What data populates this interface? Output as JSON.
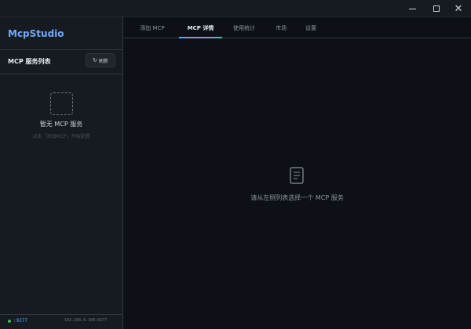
{
  "window": {
    "controls": {
      "minimize": "",
      "maximize": "",
      "close": "✕"
    }
  },
  "sidebar": {
    "brand": "McpStudio",
    "list_title": "MCP 服务列表",
    "refresh_label": "刷新",
    "refresh_icon": "↻",
    "empty_title": "暂无 MCP 服务",
    "empty_hint": "点击「添加MCP」开始配置"
  },
  "status": {
    "port": ":9277",
    "address": "192.168.6.100:9277",
    "indicator_color": "#3fb950"
  },
  "tabs": [
    {
      "label": "添加 MCP",
      "active": false
    },
    {
      "label": "MCP 详情",
      "active": true
    },
    {
      "label": "使用统计",
      "active": false
    },
    {
      "label": "市场",
      "active": false
    },
    {
      "label": "设置",
      "active": false
    }
  ],
  "main": {
    "placeholder_icon": "document-icon",
    "placeholder_text": "请从左侧列表选择一个 MCP 服务"
  },
  "colors": {
    "accent": "#58a6ff",
    "brand": "#6ea8fe",
    "background": "#0d1117",
    "sidebar": "#161b22"
  }
}
